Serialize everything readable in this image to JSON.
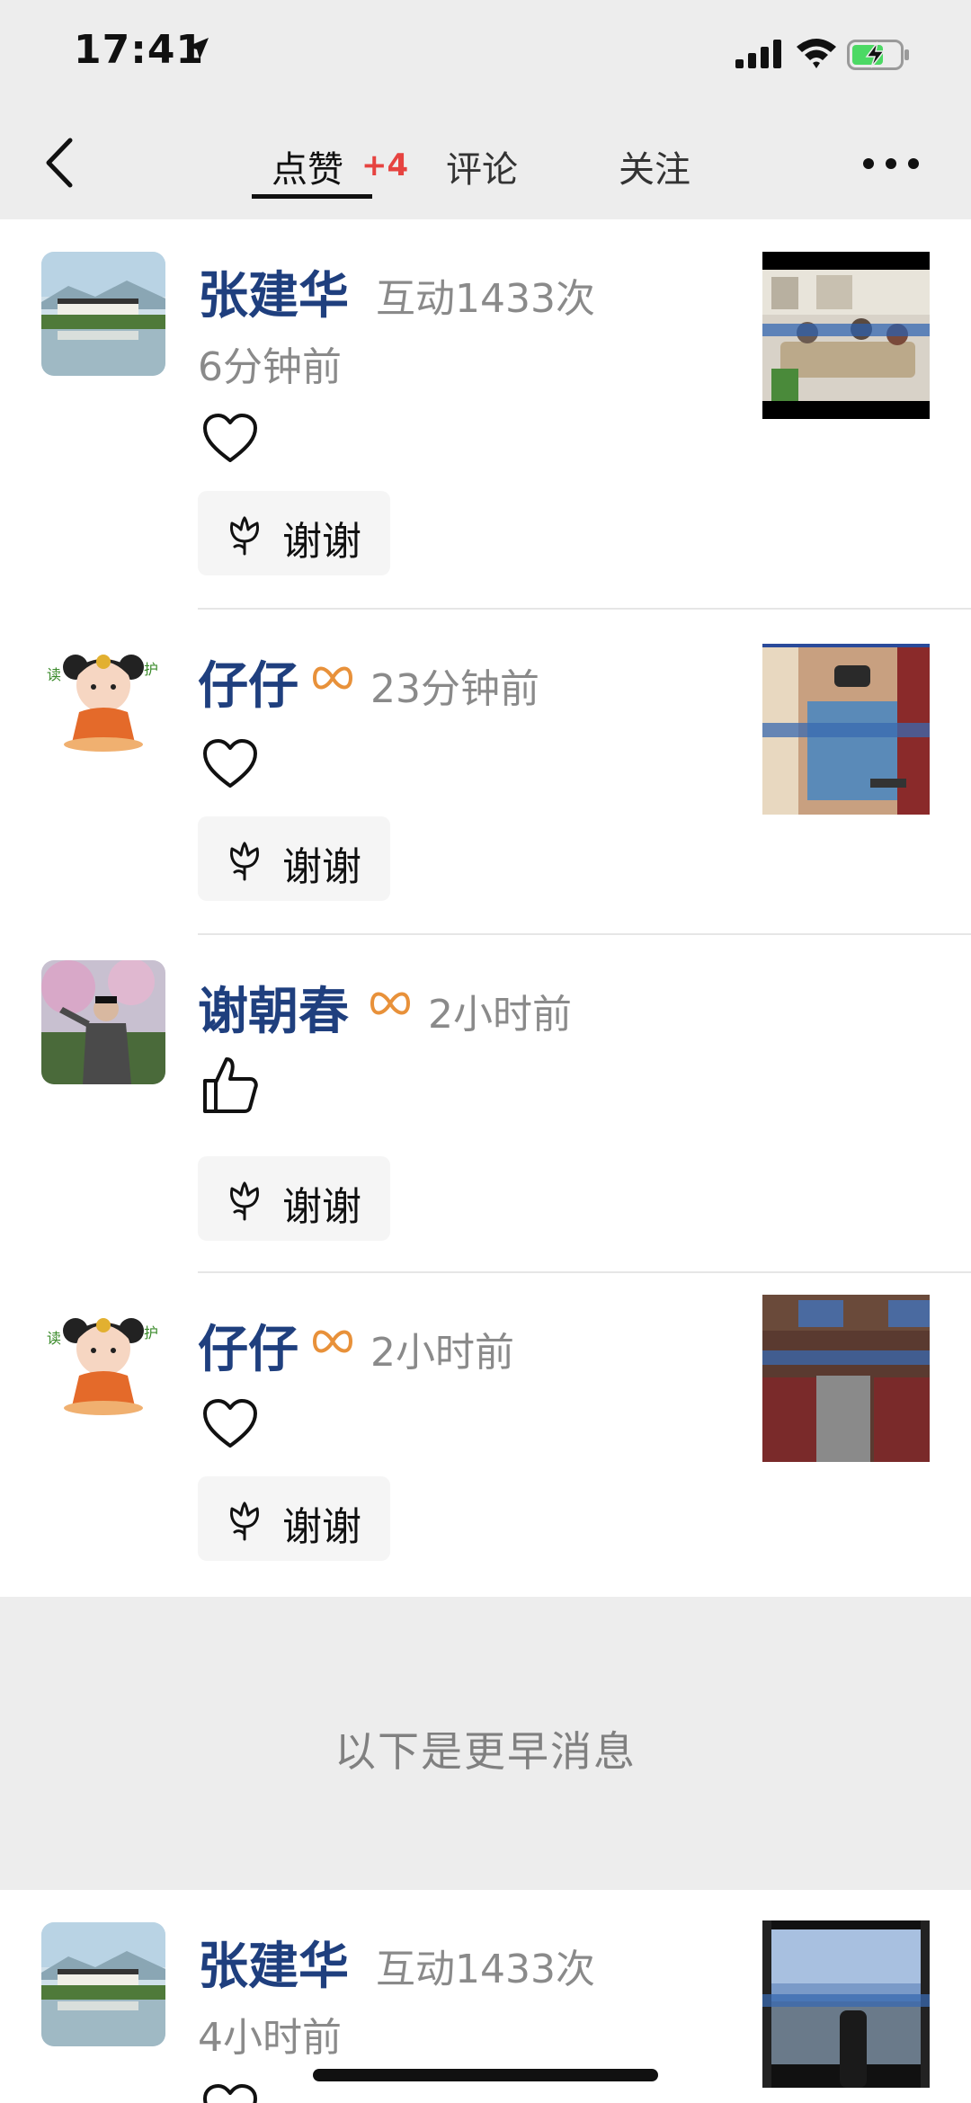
{
  "status_bar": {
    "time": "17:41"
  },
  "nav": {
    "tabs": [
      {
        "label": "点赞",
        "badge": "+4",
        "active": true
      },
      {
        "label": "评论"
      },
      {
        "label": "关注"
      }
    ]
  },
  "notifications": [
    {
      "name": "张建华",
      "interaction": "互动1433次",
      "time": "6分钟前",
      "reaction": "heart-icon",
      "reply": "谢谢"
    },
    {
      "name": "仔仔",
      "vip": true,
      "time": "23分钟前",
      "reaction": "heart-icon",
      "reply": "谢谢"
    },
    {
      "name": "谢朝春",
      "vip": true,
      "time": "2小时前",
      "reaction": "thumbs-up-icon",
      "reply": "谢谢"
    },
    {
      "name": "仔仔",
      "vip": true,
      "time": "2小时前",
      "reaction": "heart-icon",
      "reply": "谢谢"
    }
  ],
  "earlier_divider": "以下是更早消息",
  "earlier_notifications": [
    {
      "name": "张建华",
      "interaction": "互动1433次",
      "time": "4小时前",
      "reaction": "heart-icon"
    }
  ],
  "colors": {
    "name_blue": "#1f3f7e",
    "badge_red": "#e64340",
    "vip_orange": "#e8913a",
    "battery_green": "#4cd964"
  }
}
